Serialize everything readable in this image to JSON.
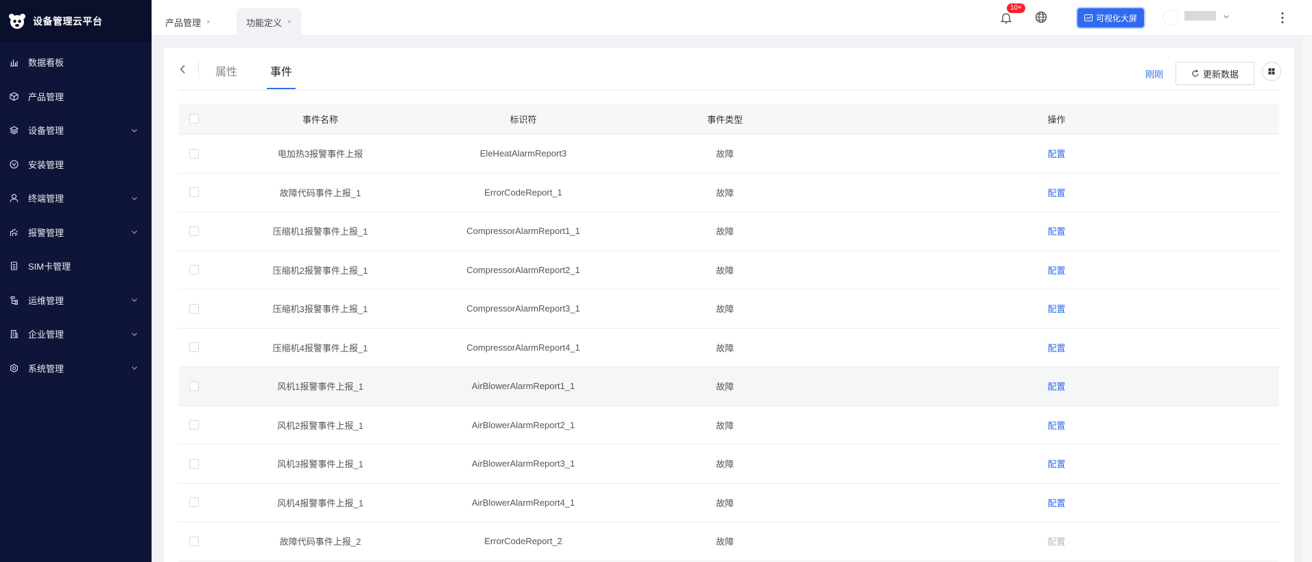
{
  "app": {
    "title": "设备管理云平台"
  },
  "sidebar": {
    "items": [
      {
        "label": "数据看板",
        "icon": "bar-chart-icon",
        "has_children": false
      },
      {
        "label": "产品管理",
        "icon": "cube-icon",
        "has_children": false
      },
      {
        "label": "设备管理",
        "icon": "layers-icon",
        "has_children": true
      },
      {
        "label": "安装管理",
        "icon": "install-icon",
        "has_children": false
      },
      {
        "label": "终端管理",
        "icon": "user-icon",
        "has_children": true
      },
      {
        "label": "报警管理",
        "icon": "alarm-icon",
        "has_children": true
      },
      {
        "label": "SIM卡管理",
        "icon": "sim-card-icon",
        "has_children": false
      },
      {
        "label": "运维管理",
        "icon": "tree-icon",
        "has_children": true
      },
      {
        "label": "企业管理",
        "icon": "building-icon",
        "has_children": true
      },
      {
        "label": "系统管理",
        "icon": "settings-icon",
        "has_children": true
      }
    ]
  },
  "tabs": [
    {
      "label": "产品管理",
      "close": "×",
      "active": false
    },
    {
      "label": "功能定义",
      "close": "×",
      "active": true
    }
  ],
  "header": {
    "notification_badge": "10+",
    "viz_button_label": "可视化大屏"
  },
  "subtabs": [
    {
      "label": "属性",
      "active": false
    },
    {
      "label": "事件",
      "active": true
    }
  ],
  "toolbar": {
    "updated_text": "刚刚",
    "refresh_label": "更新数据"
  },
  "table": {
    "columns": [
      "事件名称",
      "标识符",
      "事件类型",
      "操作"
    ],
    "rows": [
      {
        "name": "电加热3报警事件上报",
        "id": "EleHeatAlarmReport3",
        "type": "故障",
        "op": "配置",
        "op_disabled": false
      },
      {
        "name": "故障代码事件上报_1",
        "id": "ErrorCodeReport_1",
        "type": "故障",
        "op": "配置",
        "op_disabled": false
      },
      {
        "name": "压缩机1报警事件上报_1",
        "id": "CompressorAlarmReport1_1",
        "type": "故障",
        "op": "配置",
        "op_disabled": false
      },
      {
        "name": "压缩机2报警事件上报_1",
        "id": "CompressorAlarmReport2_1",
        "type": "故障",
        "op": "配置",
        "op_disabled": false
      },
      {
        "name": "压缩机3报警事件上报_1",
        "id": "CompressorAlarmReport3_1",
        "type": "故障",
        "op": "配置",
        "op_disabled": false
      },
      {
        "name": "压缩机4报警事件上报_1",
        "id": "CompressorAlarmReport4_1",
        "type": "故障",
        "op": "配置",
        "op_disabled": false
      },
      {
        "name": "风机1报警事件上报_1",
        "id": "AirBlowerAlarmReport1_1",
        "type": "故障",
        "op": "配置",
        "op_disabled": false
      },
      {
        "name": "风机2报警事件上报_1",
        "id": "AirBlowerAlarmReport2_1",
        "type": "故障",
        "op": "配置",
        "op_disabled": false
      },
      {
        "name": "风机3报警事件上报_1",
        "id": "AirBlowerAlarmReport3_1",
        "type": "故障",
        "op": "配置",
        "op_disabled": false
      },
      {
        "name": "风机4报警事件上报_1",
        "id": "AirBlowerAlarmReport4_1",
        "type": "故障",
        "op": "配置",
        "op_disabled": false
      },
      {
        "name": "故障代码事件上报_2",
        "id": "ErrorCodeReport_2",
        "type": "故障",
        "op": "配置",
        "op_disabled": true
      }
    ]
  },
  "colors": {
    "sidebar_bg": "#0f1538",
    "accent": "#2f6bf0",
    "badge": "#f5222d"
  }
}
